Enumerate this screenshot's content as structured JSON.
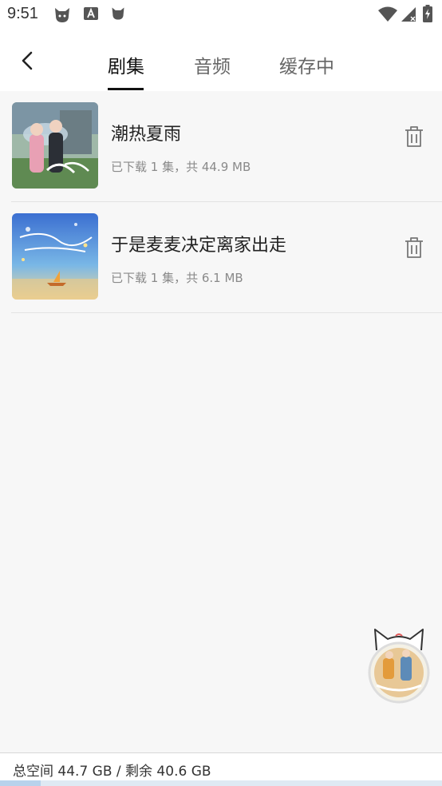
{
  "status_bar": {
    "time": "9:51",
    "left_icons": [
      "cat-icon",
      "text-a-icon",
      "cat-icon"
    ],
    "right_icons": [
      "wifi-icon",
      "signal-icon",
      "battery-charging-icon"
    ]
  },
  "header": {
    "back_icon": "chevron-left-icon",
    "tabs": [
      {
        "label": "剧集",
        "active": true
      },
      {
        "label": "音频",
        "active": false
      },
      {
        "label": "缓存中",
        "active": false
      }
    ]
  },
  "downloads": [
    {
      "title": "潮热夏雨",
      "subtitle": "已下载 1 集，共 44.9 MB",
      "action_icon": "trash-icon"
    },
    {
      "title": "于是麦麦决定离家出走",
      "subtitle": "已下载 1 集，共 6.1 MB",
      "action_icon": "trash-icon"
    }
  ],
  "footer": {
    "storage_text": "总空间 44.7 GB / 剩余 40.6 GB",
    "used_fraction": 0.092
  },
  "colors": {
    "background": "#f7f7f7",
    "active_tab": "#111111",
    "inactive_tab": "#666666",
    "subtitle": "#8a8a8a"
  }
}
